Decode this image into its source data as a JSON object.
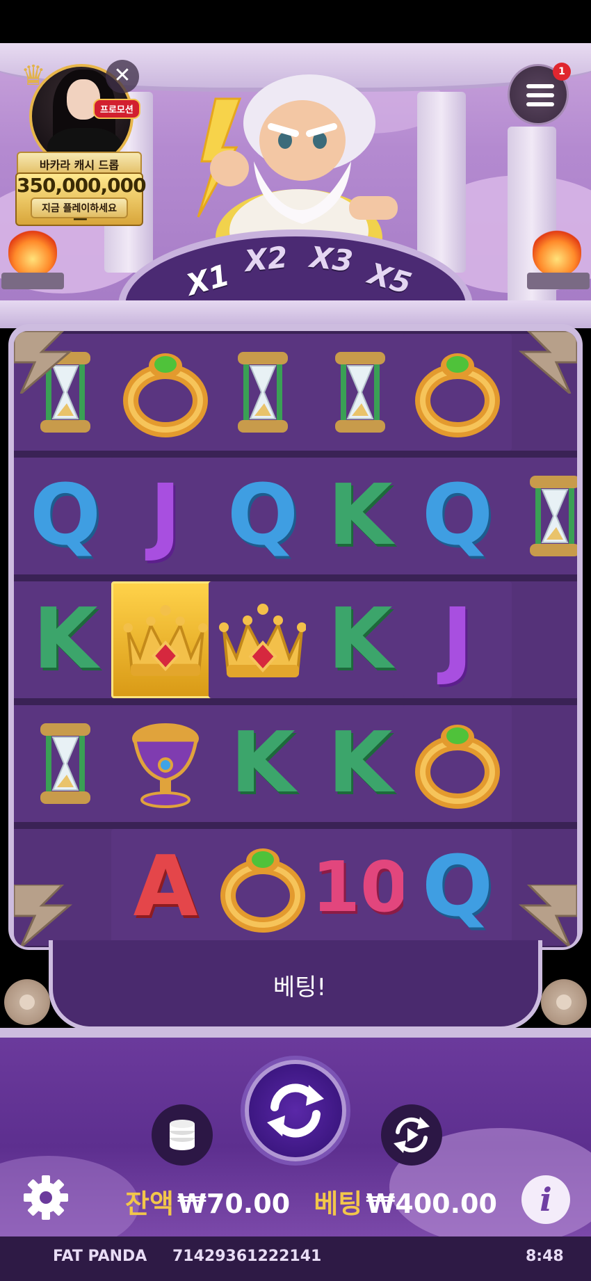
{
  "promo": {
    "tag": "프로모션",
    "title": "바카라 캐시 드롭",
    "amount": "350,000,000원",
    "cta": "지금 플레이하세요"
  },
  "menu": {
    "badge": "1"
  },
  "multipliers": [
    "X1",
    "X2",
    "X3",
    "X5"
  ],
  "active_multiplier": "X1",
  "grid": {
    "columns": 6,
    "rows": 5,
    "symbols": [
      [
        "hourglass",
        "ring",
        "hourglass",
        "hourglass",
        "ring",
        "partial"
      ],
      [
        "q",
        "j",
        "q",
        "k",
        "q",
        "hourglass"
      ],
      [
        "k",
        "crown-gold",
        "crown",
        "k",
        "j",
        "partial"
      ],
      [
        "hourglass",
        "chalice",
        "k",
        "k",
        "ring",
        "partial"
      ],
      [
        "partial",
        "a",
        "ring",
        "10",
        "q",
        "partial"
      ]
    ]
  },
  "message": "베팅!",
  "balance": {
    "label": "잔액",
    "value": "₩70.00"
  },
  "bet": {
    "label": "베팅",
    "value": "₩400.00"
  },
  "info_label": "i",
  "footer": {
    "brand": "FAT PANDA",
    "session_id": "71429361222141",
    "time": "8:48"
  },
  "colors": {
    "accent_gold": "#f2c64a",
    "reel_bg": "#5a3580",
    "frame": "#cdbcdf"
  }
}
